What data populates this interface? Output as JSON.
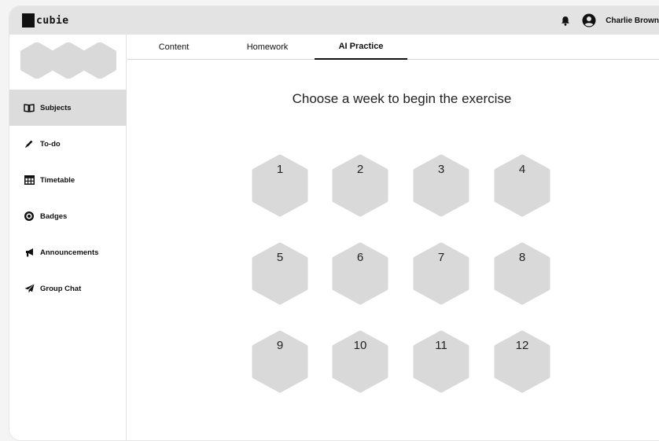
{
  "app": {
    "logo_text": "cubie",
    "user_name": "Charlie Brown"
  },
  "sidebar": {
    "items": [
      {
        "label": "Subjects",
        "icon": "book-open-icon"
      },
      {
        "label": "To-do",
        "icon": "pencil-icon"
      },
      {
        "label": "Timetable",
        "icon": "table-grid-icon"
      },
      {
        "label": "Badges",
        "icon": "badge-gear-icon"
      },
      {
        "label": "Announcements",
        "icon": "megaphone-icon"
      },
      {
        "label": "Group Chat",
        "icon": "paper-plane-icon"
      }
    ],
    "active_index": 0
  },
  "tabs": [
    {
      "label": "Content"
    },
    {
      "label": "Homework"
    },
    {
      "label": "AI Practice"
    }
  ],
  "active_tab": 2,
  "main": {
    "heading": "Choose a week to begin the exercise",
    "weeks": [
      "1",
      "2",
      "3",
      "4",
      "5",
      "6",
      "7",
      "8",
      "9",
      "10",
      "11",
      "12"
    ]
  },
  "colors": {
    "hex_fill": "#d9d9d9",
    "active_bg": "#dcdcdc",
    "topbar_bg": "#e3e3e3"
  }
}
